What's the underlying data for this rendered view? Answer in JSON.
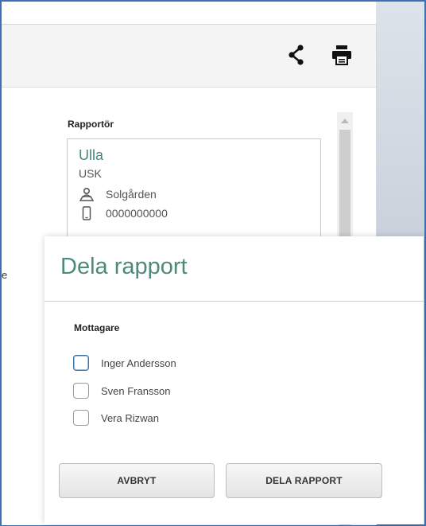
{
  "header": {
    "share_icon": "share-icon",
    "print_icon": "printer-icon"
  },
  "reporter": {
    "heading": "Rapportör",
    "name": "Ulla",
    "org": "USK",
    "location": "Solgården",
    "phone": "0000000000",
    "location_icon": "location-person-icon",
    "phone_icon": "mobile-phone-icon"
  },
  "side_text": "e",
  "modal": {
    "title": "Dela rapport",
    "recipients_label": "Mottagare",
    "recipients": [
      {
        "name": "Inger Andersson",
        "checked": false,
        "focused": true
      },
      {
        "name": "Sven Fransson",
        "checked": false,
        "focused": false
      },
      {
        "name": "Vera Rizwan",
        "checked": false,
        "focused": false
      }
    ],
    "cancel_label": "AVBRYT",
    "share_label": "DELA RAPPORT"
  },
  "colors": {
    "accent_green": "#4e8a7c",
    "frame_blue": "#3d6fb6"
  }
}
